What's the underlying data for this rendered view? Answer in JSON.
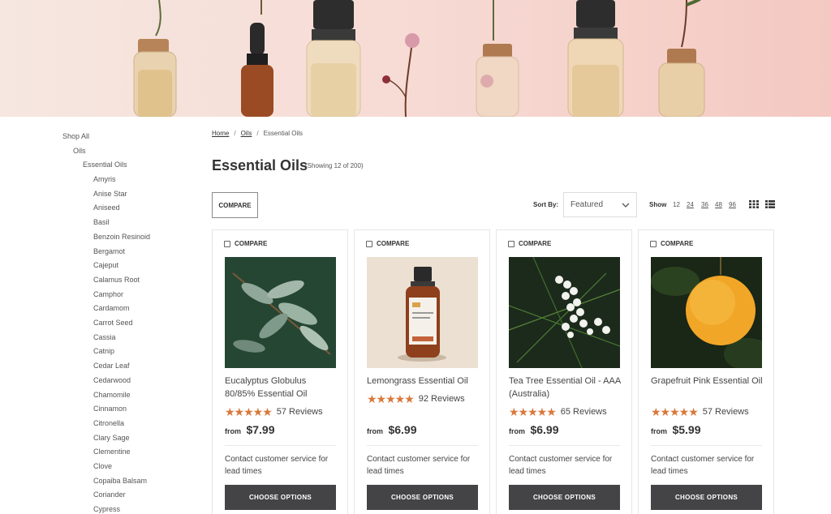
{
  "hero": {
    "alt": "essential-oil-bottles-banner"
  },
  "sidebar": {
    "shop_all": "Shop All",
    "oils": "Oils",
    "essential_oils": "Essential Oils",
    "items": [
      "Amyris",
      "Anise Star",
      "Aniseed",
      "Basil",
      "Benzoin Resinoid",
      "Bergamot",
      "Cajeput",
      "Calamus Root",
      "Camphor",
      "Cardamom",
      "Carrot Seed",
      "Cassia",
      "Catnip",
      "Cedar Leaf",
      "Cedarwood",
      "Chamomile",
      "Cinnamon",
      "Citronella",
      "Clary Sage",
      "Clementine",
      "Clove",
      "Copaiba Balsam",
      "Coriander",
      "Cypress"
    ]
  },
  "breadcrumb": {
    "home": "Home",
    "oils": "Oils",
    "current": "Essential Oils",
    "sep": "/"
  },
  "page": {
    "title": "Essential Oils",
    "showing": "(Showing 12 of 200)"
  },
  "toolbar": {
    "compare": "COMPARE",
    "sort_label": "Sort By:",
    "sort_value": "Featured",
    "show_label": "Show",
    "show_options": [
      "12",
      "24",
      "36",
      "48",
      "96"
    ]
  },
  "products": [
    {
      "compare": "COMPARE",
      "name": "Eucalyptus Globulus 80/85% Essential Oil",
      "reviews": "57 Reviews",
      "from": "from",
      "price": "$7.99",
      "lead": "Contact customer service for lead times",
      "cta": "CHOOSE OPTIONS",
      "rating": 5
    },
    {
      "compare": "COMPARE",
      "name": "Lemongrass Essential Oil",
      "reviews": "92 Reviews",
      "from": "from",
      "price": "$6.99",
      "lead": "Contact customer service for lead times",
      "cta": "CHOOSE OPTIONS",
      "rating": 5
    },
    {
      "compare": "COMPARE",
      "name": "Tea Tree Essential Oil - AAA (Australia)",
      "reviews": "65 Reviews",
      "from": "from",
      "price": "$6.99",
      "lead": "Contact customer service for lead times",
      "cta": "CHOOSE OPTIONS",
      "rating": 5
    },
    {
      "compare": "COMPARE",
      "name": "Grapefruit Pink Essential Oil",
      "reviews": "57 Reviews",
      "from": "from",
      "price": "$5.99",
      "lead": "Contact customer service for lead times",
      "cta": "CHOOSE OPTIONS",
      "rating": 5
    }
  ],
  "colors": {
    "star": "#d9783a",
    "button": "#444447",
    "banner": "#f7dcd6"
  }
}
